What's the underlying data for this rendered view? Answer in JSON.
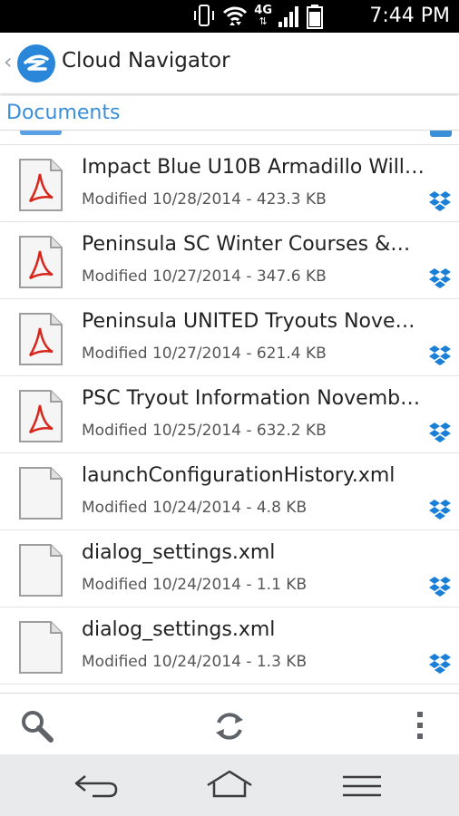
{
  "status_bar": {
    "time": "7:44 PM",
    "network": "4G",
    "icons": [
      "vibrate-icon",
      "wifi-icon",
      "mobile-data-icon",
      "signal-icon",
      "battery-icon"
    ]
  },
  "app_bar": {
    "title": "Cloud Navigator",
    "back_glyph": "‹"
  },
  "breadcrumb": {
    "label": "Documents"
  },
  "files": [
    {
      "name": "Impact Blue U10B  Armadillo Will…",
      "meta": "Modified 10/28/2014 - 423.3 KB",
      "type": "pdf",
      "source": "dropbox"
    },
    {
      "name": "Peninsula SC   Winter Courses &…",
      "meta": "Modified 10/27/2014 - 347.6 KB",
      "type": "pdf",
      "source": "dropbox"
    },
    {
      "name": "Peninsula UNITED Tryouts Nove…",
      "meta": "Modified 10/27/2014 - 621.4 KB",
      "type": "pdf",
      "source": "dropbox"
    },
    {
      "name": "PSC Tryout Information Novemb…",
      "meta": "Modified 10/25/2014 - 632.2 KB",
      "type": "pdf",
      "source": "dropbox"
    },
    {
      "name": "launchConfigurationHistory.xml",
      "meta": "Modified 10/24/2014 - 4.8 KB",
      "type": "generic",
      "source": "dropbox"
    },
    {
      "name": "dialog_settings.xml",
      "meta": "Modified 10/24/2014 - 1.1 KB",
      "type": "generic",
      "source": "dropbox"
    },
    {
      "name": "dialog_settings.xml",
      "meta": "Modified 10/24/2014 - 1.3 KB",
      "type": "generic",
      "source": "dropbox"
    }
  ],
  "toolbar": {
    "icons": [
      "search-icon",
      "refresh-icon",
      "overflow-menu-icon"
    ]
  },
  "nav_bar": {
    "icons": [
      "back-icon",
      "home-icon",
      "menu-icon"
    ]
  },
  "colors": {
    "accent": "#3b8fd8",
    "dropbox": "#1a7fd6",
    "pdf_red": "#d9261c"
  }
}
